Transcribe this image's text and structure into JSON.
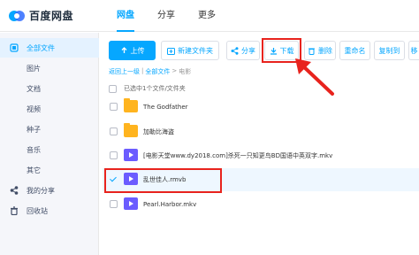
{
  "app": {
    "logo_text": "百度网盘",
    "colors": {
      "accent": "#06a7ff",
      "annotation": "#e8231d",
      "folder": "#ffb41f",
      "video": "#6b5cff"
    }
  },
  "nav": {
    "items": [
      {
        "label": "网盘",
        "active": true
      },
      {
        "label": "分享",
        "active": false
      },
      {
        "label": "更多",
        "active": false
      }
    ]
  },
  "sidebar": {
    "items": [
      {
        "label": "全部文件",
        "icon": "files-icon",
        "active": true
      },
      {
        "label": "图片"
      },
      {
        "label": "文档"
      },
      {
        "label": "视频"
      },
      {
        "label": "种子"
      },
      {
        "label": "音乐"
      },
      {
        "label": "其它"
      },
      {
        "label": "我的分享",
        "icon": "share-icon"
      },
      {
        "label": "回收站",
        "icon": "trash-icon"
      }
    ]
  },
  "toolbar": {
    "upload_label": "上传",
    "new_folder_label": "新建文件夹",
    "share_label": "分享",
    "download_label": "下载",
    "delete_label": "删除",
    "rename_label": "重命名",
    "copy_label": "复制到",
    "move_label": "移"
  },
  "breadcrumb": {
    "back": "返回上一级",
    "all": "全部文件",
    "sep": "|",
    "arrow": ">",
    "current": "电影"
  },
  "selection": {
    "status": "已选中1个文件/文件夹"
  },
  "files": [
    {
      "name": "The Godfather",
      "type": "folder",
      "selected": false
    },
    {
      "name": "加勒比海盗",
      "type": "folder",
      "selected": false
    },
    {
      "name": "[电影天堂www.dy2018.com]杀死一只知更鸟BD国语中英双字.mkv",
      "type": "video",
      "selected": false
    },
    {
      "name": "乱世佳人.rmvb",
      "type": "video",
      "selected": true
    },
    {
      "name": "Pearl.Harbor.mkv",
      "type": "video",
      "selected": false
    }
  ]
}
